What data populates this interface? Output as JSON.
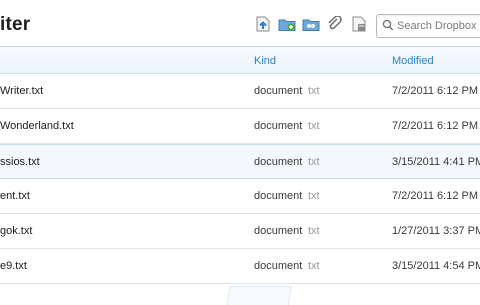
{
  "header": {
    "title": "iter",
    "search_placeholder": "Search Dropbox",
    "tools": [
      "upload-icon",
      "new-folder-icon",
      "share-folder-icon",
      "attachment-link-icon",
      "deleted-files-icon"
    ]
  },
  "columns": {
    "kind": "Kind",
    "modified": "Modified"
  },
  "files": [
    {
      "name": "Writer.txt",
      "kind": "document",
      "ext": "txt",
      "modified": "7/2/2011 6:12 PM"
    },
    {
      "name": " Wonderland.txt",
      "kind": "document",
      "ext": "txt",
      "modified": "7/2/2011 6:12 PM"
    },
    {
      "name": "ssios.txt",
      "kind": "document",
      "ext": "txt",
      "modified": "3/15/2011 4:41 PM"
    },
    {
      "name": "ent.txt",
      "kind": "document",
      "ext": "txt",
      "modified": "7/2/2011 6:12 PM"
    },
    {
      "name": "gok.txt",
      "kind": "document",
      "ext": "txt",
      "modified": "1/27/2011 3:37 PM"
    },
    {
      "name": "e9.txt",
      "kind": "document",
      "ext": "txt",
      "modified": "3/15/2011 4:54 PM"
    }
  ],
  "colors": {
    "accent": "#2a83c5",
    "header_bg": "#eaf4fb",
    "selected_row": "#f2f8fc"
  }
}
